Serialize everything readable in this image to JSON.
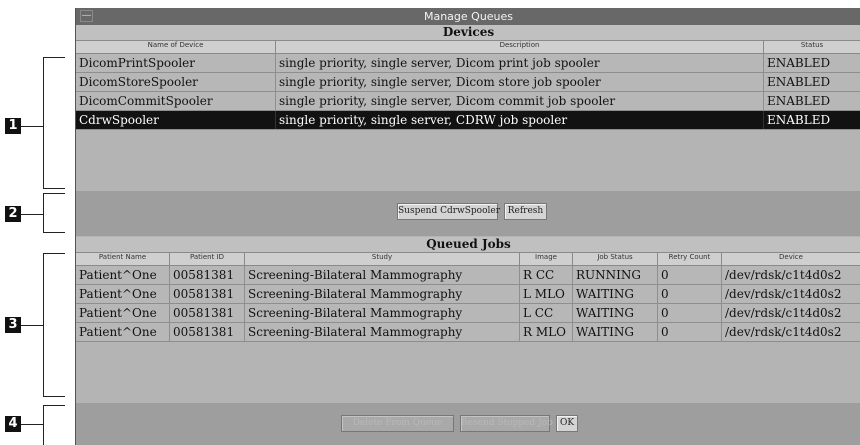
{
  "window": {
    "title": "Manage Queues",
    "menu_glyph": "—"
  },
  "devices": {
    "section_title": "Devices",
    "headers": [
      "Name of Device",
      "Description",
      "Status"
    ],
    "rows": [
      {
        "name": "DicomPrintSpooler",
        "description": "single priority, single server, Dicom print job spooler",
        "status": "ENABLED"
      },
      {
        "name": "DicomStoreSpooler",
        "description": "single priority, single server, Dicom store job spooler",
        "status": "ENABLED"
      },
      {
        "name": "DicomCommitSpooler",
        "description": "single priority, single server, Dicom commit job spooler",
        "status": "ENABLED"
      },
      {
        "name": "CdrwSpooler",
        "description": "single priority, single server, CDRW job spooler",
        "status": "ENABLED"
      }
    ],
    "selected_row": 3
  },
  "device_buttons": {
    "suspend": "Suspend CdrwSpooler",
    "refresh": "Refresh"
  },
  "jobs": {
    "section_title": "Queued Jobs",
    "headers": [
      "Patient Name",
      "Patient ID",
      "Study",
      "Image",
      "Job Status",
      "Retry Count",
      "Device"
    ],
    "rows": [
      {
        "patient_name": "Patient^One",
        "patient_id": "00581381",
        "study": "Screening-Bilateral Mammography",
        "image": "R CC",
        "job_status": "RUNNING",
        "retry": "0",
        "device": "/dev/rdsk/c1t4d0s2"
      },
      {
        "patient_name": "Patient^One",
        "patient_id": "00581381",
        "study": "Screening-Bilateral Mammography",
        "image": "L MLO",
        "job_status": "WAITING",
        "retry": "0",
        "device": "/dev/rdsk/c1t4d0s2"
      },
      {
        "patient_name": "Patient^One",
        "patient_id": "00581381",
        "study": "Screening-Bilateral Mammography",
        "image": "L CC",
        "job_status": "WAITING",
        "retry": "0",
        "device": "/dev/rdsk/c1t4d0s2"
      },
      {
        "patient_name": "Patient^One",
        "patient_id": "00581381",
        "study": "Screening-Bilateral Mammography",
        "image": "R MLO",
        "job_status": "WAITING",
        "retry": "0",
        "device": "/dev/rdsk/c1t4d0s2"
      }
    ]
  },
  "job_buttons": {
    "delete": "Delete From Queue",
    "resend": "Resend Stopped Job",
    "ok": "OK"
  },
  "callouts": [
    "1",
    "2",
    "3",
    "4"
  ]
}
